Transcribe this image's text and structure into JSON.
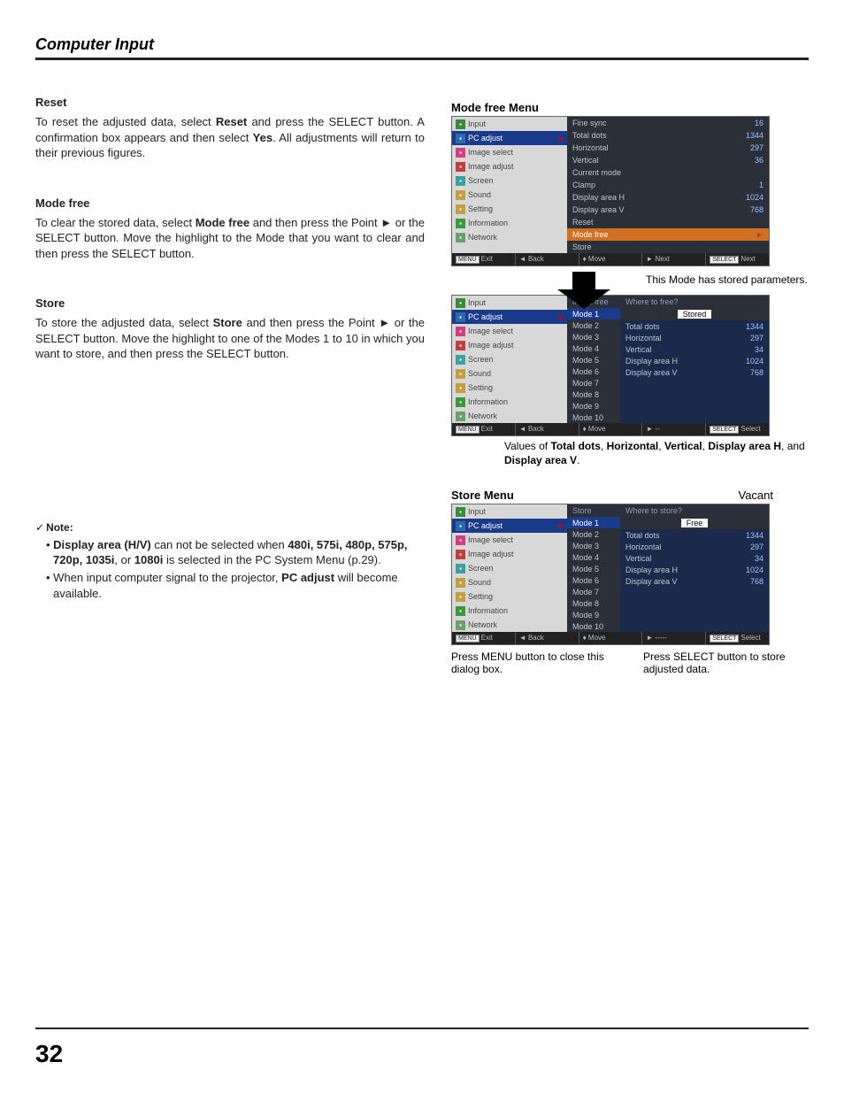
{
  "header": "Computer Input",
  "page_number": "32",
  "left": {
    "reset": {
      "title": "Reset",
      "body_pre": "To reset the adjusted data, select ",
      "body_b1": "Reset",
      "body_mid": " and press the SELECT button. A confirmation box appears and then select ",
      "body_b2": "Yes",
      "body_post": ". All adjustments will return to their previous figures."
    },
    "modefree": {
      "title": "Mode free",
      "body_pre": "To clear the stored data, select ",
      "body_b1": "Mode free",
      "body_post": " and then press the Point ► or the SELECT button. Move the highlight to the Mode that you want to clear and then press the SELECT button."
    },
    "store": {
      "title": "Store",
      "body_pre": "To store the adjusted data, select ",
      "body_b1": "Store",
      "body_post": " and then press the Point ► or the SELECT button. Move the highlight to one of the Modes 1 to 10 in which you want to store, and then press the SELECT button."
    },
    "note": {
      "title": "Note:",
      "item1_pre": "Display area (H/V)",
      "item1_mid": " can not be selected when ",
      "item1_b_list": "480i, 575i, 480p, 575p, 720p, 1035i",
      "item1_or": ", or ",
      "item1_b_last": "1080i",
      "item1_post": " is selected in the PC System Menu (p.29).",
      "item2_pre": "When input computer signal to the projector, ",
      "item2_b": "PC adjust",
      "item2_post": " will become available."
    }
  },
  "right": {
    "modefree_title": "Mode free Menu",
    "store_title": "Store Menu",
    "vacant_label": "Vacant",
    "stored_annot": "This Mode has stored parameters.",
    "values_caption_pre": "Values of ",
    "values_caption_b1": "Total dots",
    "values_caption_s1": ", ",
    "values_caption_b2": "Horizontal",
    "values_caption_s2": ", ",
    "values_caption_b3": "Vertical",
    "values_caption_s3": ", ",
    "values_caption_b4": "Display area H",
    "values_caption_s4": ", and ",
    "values_caption_b5": "Display area V",
    "values_caption_post": ".",
    "cap_menu": "Press MENU button to close this dialog box.",
    "cap_select": "Press SELECT button to store adjusted data."
  },
  "menu_items": [
    {
      "icon": "i-green",
      "label": "Input"
    },
    {
      "icon": "i-blue",
      "label": "PC adjust",
      "sel": true
    },
    {
      "icon": "i-pink",
      "label": "Image select"
    },
    {
      "icon": "i-red",
      "label": "Image adjust"
    },
    {
      "icon": "i-teal",
      "label": "Screen"
    },
    {
      "icon": "i-yellow",
      "label": "Sound"
    },
    {
      "icon": "i-yellow",
      "label": "Setting"
    },
    {
      "icon": "i-info",
      "label": "Information"
    },
    {
      "icon": "i-net",
      "label": "Network"
    }
  ],
  "osd1_rows": [
    {
      "l": "Fine sync",
      "v": "16"
    },
    {
      "l": "Total dots",
      "v": "1344"
    },
    {
      "l": "Horizontal",
      "v": "297"
    },
    {
      "l": "Vertical",
      "v": "36"
    },
    {
      "l": "Current mode",
      "v": ""
    },
    {
      "l": "Clamp",
      "v": "1"
    },
    {
      "l": "Display area H",
      "v": "1024"
    },
    {
      "l": "Display area V",
      "v": "768"
    },
    {
      "l": "Reset",
      "v": ""
    },
    {
      "l": "Mode free",
      "v": "",
      "hl": true,
      "tri": true
    },
    {
      "l": "Store",
      "v": ""
    }
  ],
  "osd2": {
    "top_l": "Mode free",
    "top_q": "Where to free?",
    "top_badge": "Stored",
    "modes": [
      "Mode 1",
      "Mode 2",
      "Mode 3",
      "Mode 4",
      "Mode 5",
      "Mode 6",
      "Mode 7",
      "Mode 8",
      "Mode 9",
      "Mode 10"
    ],
    "params": [
      {
        "l": "Total dots",
        "v": "1344"
      },
      {
        "l": "Horizontal",
        "v": "297"
      },
      {
        "l": "Vertical",
        "v": "34"
      },
      {
        "l": "Display area H",
        "v": "1024"
      },
      {
        "l": "Display area V",
        "v": "768"
      }
    ]
  },
  "osd3": {
    "top_l": "Store",
    "top_q": "Where to store?",
    "top_badge": "Free",
    "modes": [
      "Mode 1",
      "Mode 2",
      "Mode 3",
      "Mode 4",
      "Mode 5",
      "Mode 6",
      "Mode 7",
      "Mode 8",
      "Mode 9",
      "Mode 10"
    ],
    "params": [
      {
        "l": "Total dots",
        "v": "1344"
      },
      {
        "l": "Horizontal",
        "v": "297"
      },
      {
        "l": "Vertical",
        "v": "34"
      },
      {
        "l": "Display area H",
        "v": "1024"
      },
      {
        "l": "Display area V",
        "v": "768"
      }
    ]
  },
  "footbar": {
    "exit": "Exit",
    "back": "Back",
    "move": "Move",
    "next": "Next",
    "next2": "Next",
    "select": "Select",
    "dashes": "-----",
    "dashes2": "--"
  }
}
